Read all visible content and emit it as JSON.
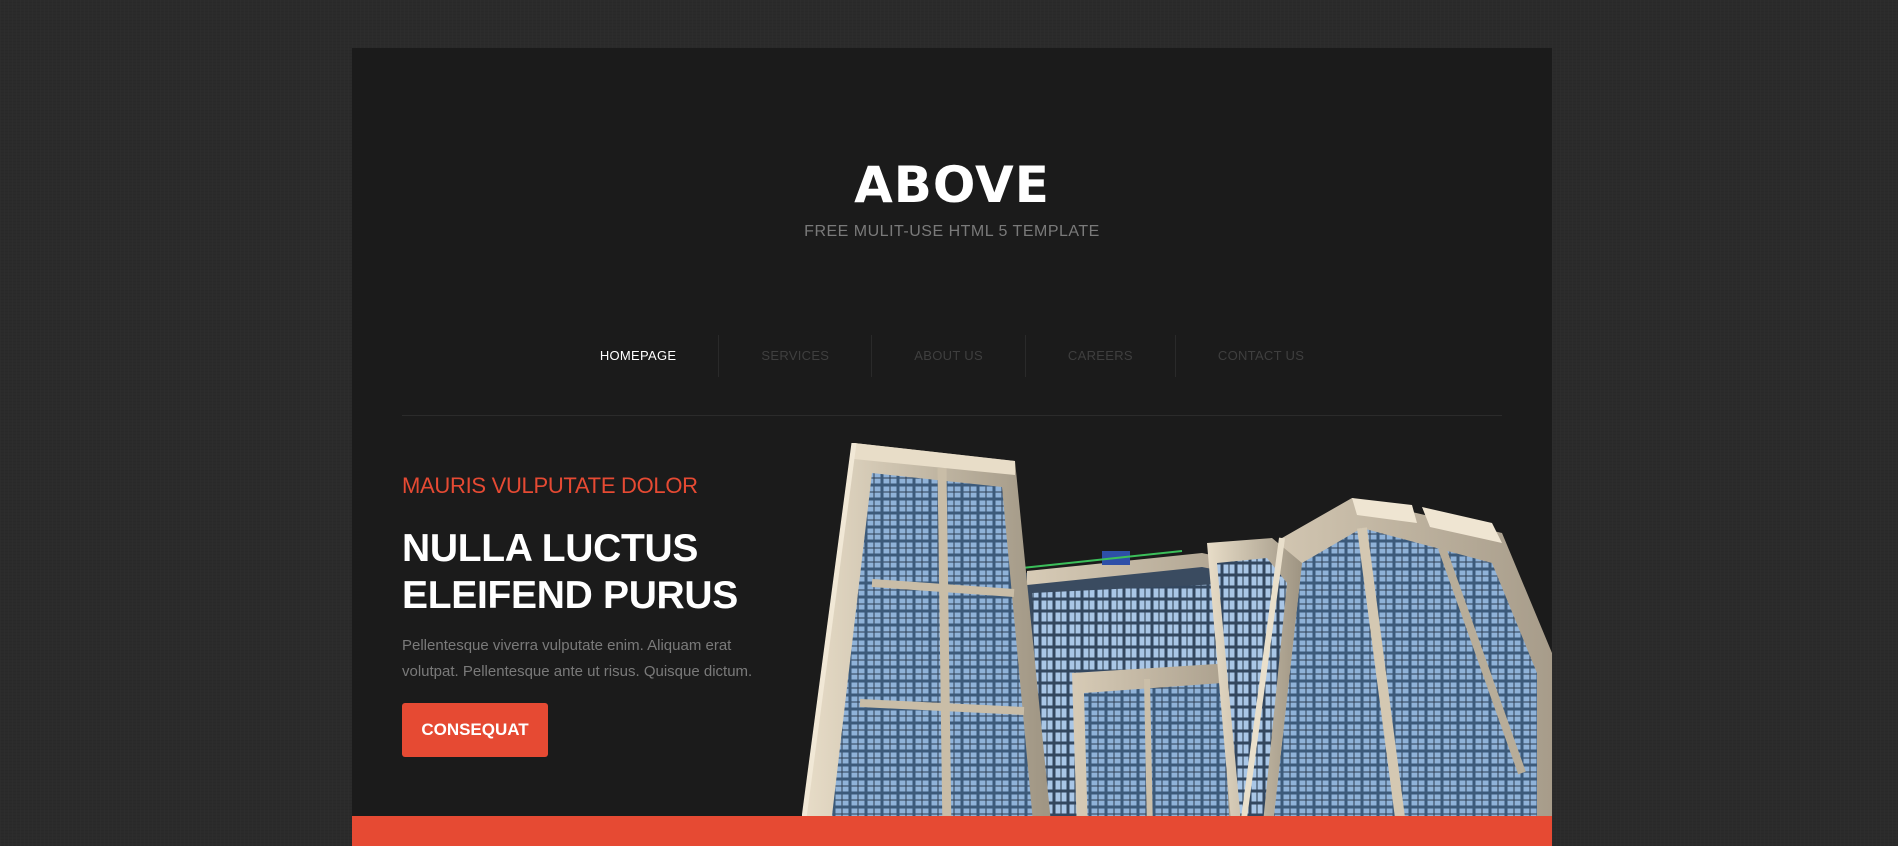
{
  "brand": {
    "title": "ABOVE",
    "tagline": "FREE MULIT-USE HTML 5 TEMPLATE"
  },
  "nav": {
    "items": [
      {
        "label": "HOMEPAGE",
        "active": true
      },
      {
        "label": "SERVICES",
        "active": false
      },
      {
        "label": "ABOUT US",
        "active": false
      },
      {
        "label": "CAREERS",
        "active": false
      },
      {
        "label": "CONTACT US",
        "active": false
      }
    ]
  },
  "hero": {
    "eyebrow": "MAURIS VULPUTATE DOLOR",
    "headline_line1": "NULLA LUCTUS",
    "headline_line2": "ELEIFEND PURUS",
    "body_line1": "Pellentesque viverra vulputate enim. Aliquam erat",
    "body_line2": "volutpat. Pellentesque ante ut risus. Quisque dictum.",
    "cta_label": "CONSEQUAT",
    "image_icon": "skyscraper-photo"
  },
  "colors": {
    "accent": "#e64a33",
    "page_bg": "#1b1b1b",
    "outer_bg": "#2b2b2b",
    "nav_inactive": "#3f3f3f",
    "muted_text": "#7a7a7a"
  }
}
